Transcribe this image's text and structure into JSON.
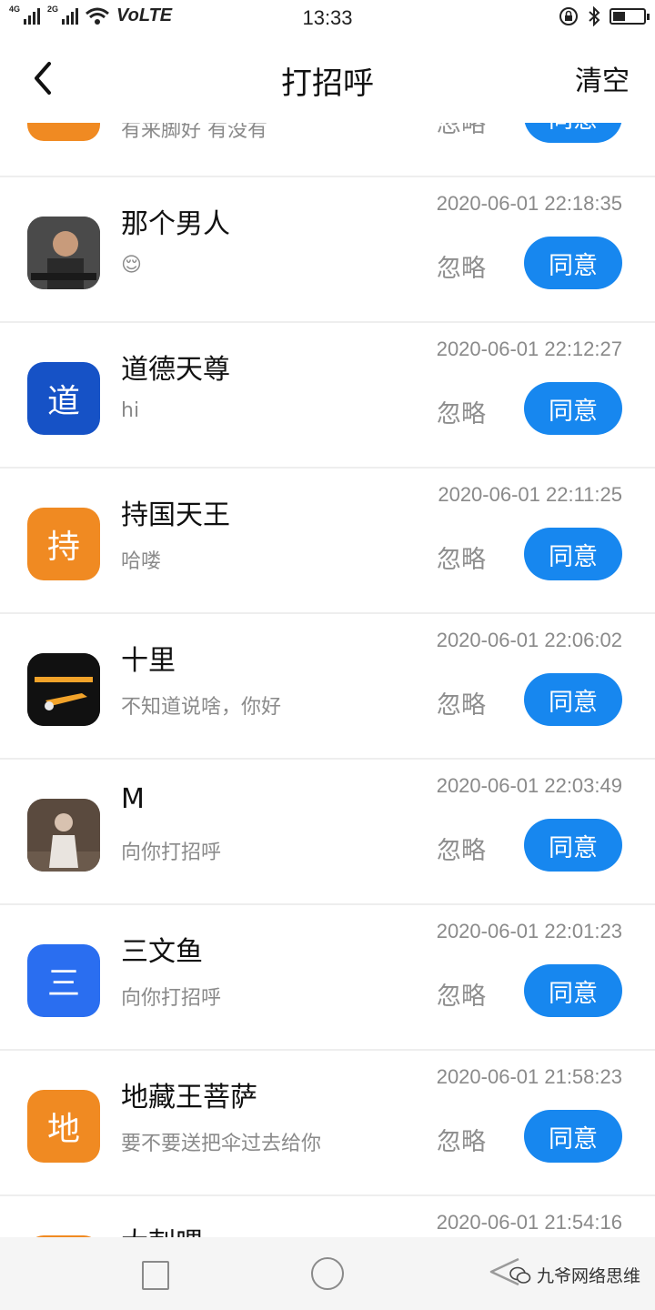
{
  "status_bar": {
    "network": "4G",
    "network2": "2G",
    "carrier": "VoLTE",
    "time": "13:33",
    "battery_level": 0.4
  },
  "nav": {
    "title": "打招呼",
    "clear": "清空"
  },
  "partial_top": {
    "msg": "有来脚好 有没有",
    "ignore": "忽略",
    "agree": "同意"
  },
  "items": [
    {
      "name": "那个男人",
      "msg": "😌",
      "time": "2020-06-01 22:18:35",
      "avatar_char": "",
      "avatar_color": "#3a3a3a"
    },
    {
      "name": "道德天尊",
      "msg": "hi",
      "time": "2020-06-01 22:12:27",
      "avatar_char": "道",
      "avatar_color": "#1652c6"
    },
    {
      "name": "持国天王",
      "msg": "哈喽",
      "time": "2020-06-01 22:11:25",
      "avatar_char": "持",
      "avatar_color": "#f08a22"
    },
    {
      "name": "十里",
      "msg": "不知道说啥，你好",
      "time": "2020-06-01 22:06:02",
      "avatar_char": "",
      "avatar_color": "#111111"
    },
    {
      "name": "M",
      "msg": "向你打招呼",
      "time": "2020-06-01 22:03:49",
      "avatar_char": "",
      "avatar_color": "#5a4a3e"
    },
    {
      "name": "三文鱼",
      "msg": "向你打招呼",
      "time": "2020-06-01 22:01:23",
      "avatar_char": "三",
      "avatar_color": "#2a6ef0"
    },
    {
      "name": "地藏王菩萨",
      "msg": "要不要送把伞过去给你",
      "time": "2020-06-01 21:58:23",
      "avatar_char": "地",
      "avatar_color": "#f08a22"
    },
    {
      "name": "大刺喂",
      "msg": "",
      "time": "2020-06-01 21:54:16",
      "avatar_char": "",
      "avatar_color": "#f08a22"
    }
  ],
  "actions": {
    "ignore": "忽略",
    "agree": "同意"
  },
  "watermark": "九爷网络思维"
}
